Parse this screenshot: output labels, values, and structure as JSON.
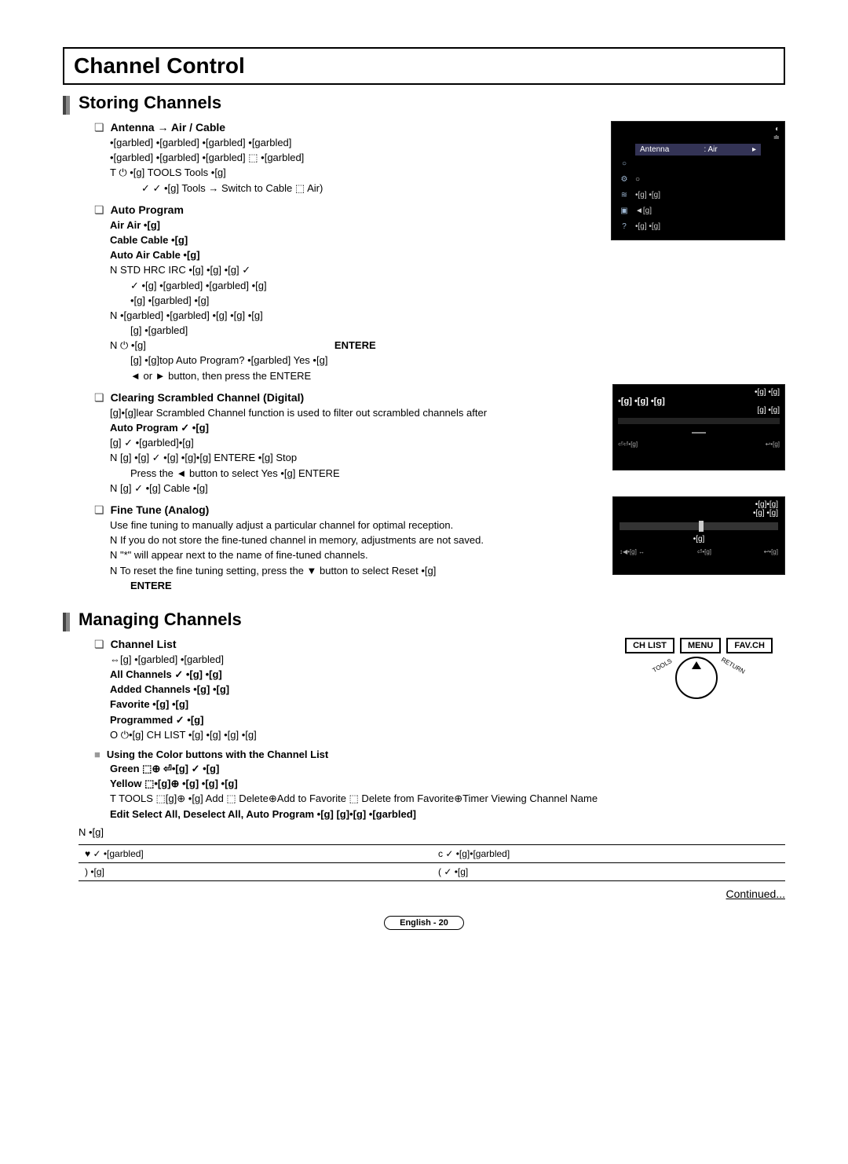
{
  "header": {
    "title": "Channel Control"
  },
  "sect1": {
    "title": "Storing Channels",
    "antenna": {
      "title": "Antenna → Air / Cable",
      "line1": "•[garbled] •[garbled] •[garbled] •[garbled]",
      "line2": "•[garbled] •[garbled] •[garbled] ⬚ •[garbled]",
      "t_line": "T   ⏻ •[g]   TOOLS                Tools •[g]",
      "t_line2": "      ✓  ✓ •[g]                        Tools → Switch to Cable ⬚ Air)"
    },
    "auto": {
      "title": "Auto Program",
      "b": [
        "Air  Air •[g]",
        "Cable  Cable •[g]",
        "Auto  Air      Cable •[g]"
      ],
      "n1": "N   STD  HRC     IRC •[g] •[g] •[g]  ✓",
      "n1b": [
        "✓ •[g]  •[garbled]  •[garbled] •[g]",
        "•[g]  •[garbled] •[g]"
      ],
      "n2": "N   •[garbled] •[garbled] •[g] •[g] •[g]",
      "n2b": "[g] •[garbled]",
      "n3pre": "N       ⏻ •[g]",
      "n3mid": "ENTERE",
      "n3b": "[g] •[g]top Auto Program? •[garbled]          Yes •[g]",
      "n3c": "◄ or ► button, then press the ENTERE"
    },
    "clear": {
      "title": "Clearing Scrambled Channel (Digital)",
      "l1": "[g]•[g]lear Scrambled Channel function is used to filter out scrambled channels after",
      "l2": "Auto Program  ✓ •[g]",
      "l3": "[g] ✓ •[garbled]•[g]",
      "n1": "N   [g]  •[g] ✓ •[g] •[g]•[g]               ENTERE    •[g]        Stop",
      "n1b": "Press the ◄ button to select Yes •[g]       ENTERE",
      "n2": "N   [g] ✓  •[g]               Cable •[g]"
    },
    "fine": {
      "title": "Fine Tune (Analog)",
      "l1": "Use fine tuning to manually adjust a particular channel for optimal reception.",
      "n1": "N   If you do not store the fine-tuned channel in memory, adjustments are not saved.",
      "n2": "N   \"*\" will appear next to the name of fine-tuned channels.",
      "n3": "N   To reset the fine tuning setting, press the ▼ button to select Reset •[g]",
      "n3b": "ENTERE"
    },
    "screen1": {
      "hdr_left": "Antenna",
      "hdr_right": ": Air",
      "rows": [
        {
          "ico": "○",
          "txt": ""
        },
        {
          "ico": "⚙",
          "txt": "○"
        },
        {
          "ico": "≋",
          "txt": "•[g] •[g]"
        },
        {
          "ico": "▣",
          "txt": "◄[g]"
        },
        {
          "ico": "?",
          "txt": "•[g] •[g]"
        }
      ],
      "top_icons": [
        "◐",
        "≐"
      ]
    },
    "screen2": {
      "t1": "•[g] •[g]",
      "t2": "•[g] •[g] •[g]",
      "t3": "[g] •[g]",
      "btn": " ",
      "ftr_l": "⏎⏎•[g]",
      "ftr_r": "↩•[g]"
    },
    "screen3": {
      "t1": "•[g]•[g]",
      "t2": "•[g] •[g]",
      "btn": "•[g]",
      "ftr_l": "↕◀•[g]  ↔",
      "ftr_m": "⏎•[g]",
      "ftr_r": "↩•[g]"
    }
  },
  "sect2": {
    "title": "Managing Channels",
    "chlist": {
      "title": "Channel List",
      "lead": "⇔[g]   •[garbled] •[garbled]",
      "items": [
        "All Channels          ✓ •[g] •[g]",
        "Added Channels   •[g] •[g]",
        "Favorite   •[g] •[g]",
        "Programmed          ✓ •[g]"
      ],
      "o": "O   ⏻•[g]     CH LIST   •[g]          •[g]    •[g]                  •[g]"
    },
    "color": {
      "title": "Using the Color buttons with the Channel List",
      "green": "Green ⬚⊕ ⏎•[g]       ✓ •[g]",
      "yellow": "Yellow ⬚•[g]⊕ •[g] •[g] •[g]",
      "tools": "T TOOLS ⬚[g]⊕ •[g]        Add ⬚ Delete⊕Add to Favorite ⬚ Delete from Favorite⊕Timer Viewing  Channel Name",
      "edit": "Edit  Select All, Deselect All,      Auto Program •[g] [g]•[g] •[garbled]"
    },
    "nline": "N   •[g]",
    "legend": {
      "r1c1": "♥     ✓ •[garbled]",
      "r1c2": "c      ✓ •[g]•[garbled]",
      "r2c1": ")      •[g]",
      "r2c2": "(      ✓ •[g]"
    },
    "remote": {
      "b1": "CH LIST",
      "b2": "MENU",
      "b3": "FAV.CH",
      "side_l": "TOOLS",
      "side_r": "RETURN"
    }
  },
  "footer": {
    "cont": "Continued...",
    "pill": "English - 20"
  }
}
